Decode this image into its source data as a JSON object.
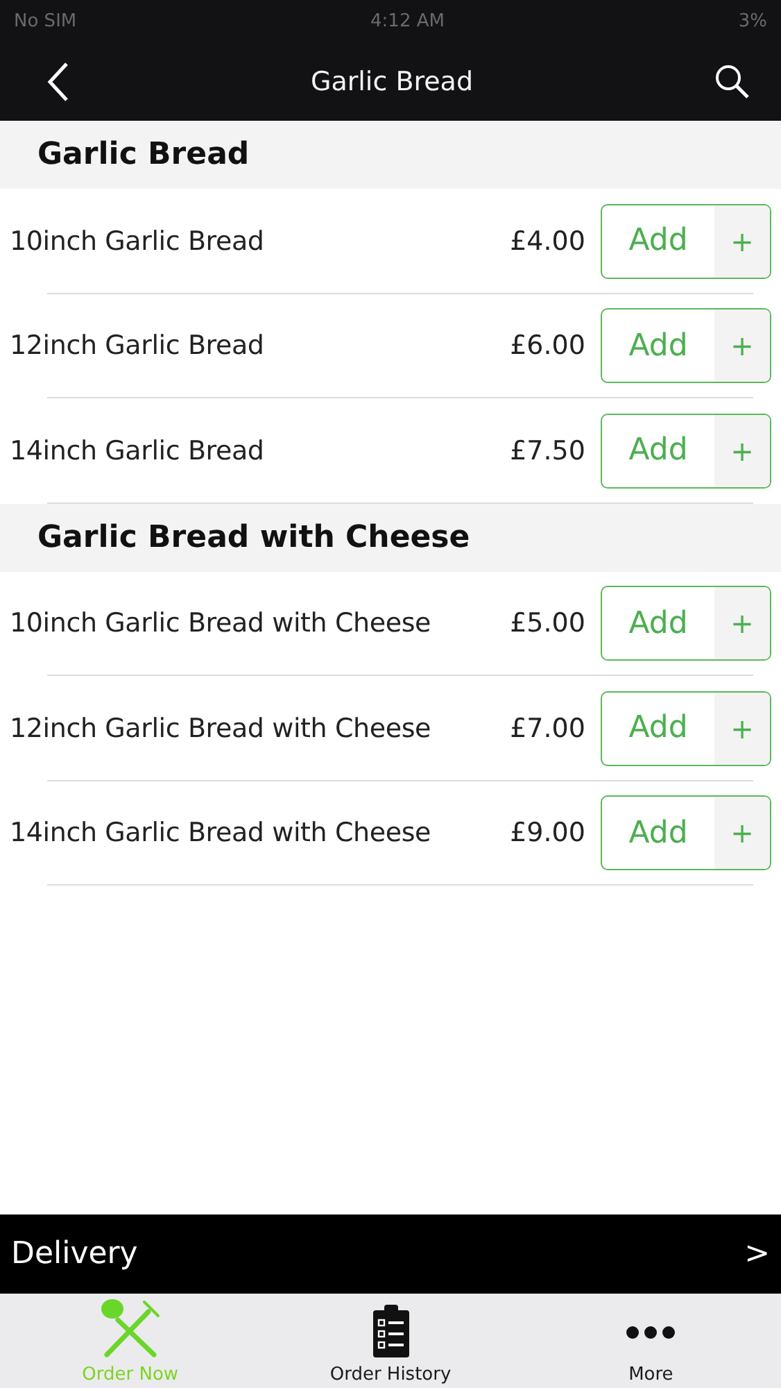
{
  "status_bar": {
    "carrier": "No SIM",
    "time": "4:12 AM",
    "battery": "3%"
  },
  "nav": {
    "title": "Garlic Bread"
  },
  "sections": [
    {
      "title": "Garlic Bread",
      "items": [
        {
          "name": "10inch Garlic Bread",
          "price": "£4.00",
          "button": "Add",
          "plus": "+"
        },
        {
          "name": "12inch Garlic Bread",
          "price": "£6.00",
          "button": "Add",
          "plus": "+"
        },
        {
          "name": "14inch Garlic Bread",
          "price": "£7.50",
          "button": "Add",
          "plus": "+"
        }
      ]
    },
    {
      "title": "Garlic Bread with Cheese",
      "items": [
        {
          "name": "10inch Garlic Bread with Cheese",
          "price": "£5.00",
          "button": "Add",
          "plus": "+"
        },
        {
          "name": "12inch Garlic Bread with Cheese",
          "price": "£7.00",
          "button": "Add",
          "plus": "+"
        },
        {
          "name": "14inch Garlic Bread with Cheese",
          "price": "£9.00",
          "button": "Add",
          "plus": "+"
        }
      ]
    }
  ],
  "delivery": {
    "label": "Delivery",
    "arrow": ">"
  },
  "tabs": [
    {
      "kind": "order",
      "label": "Order Now",
      "selected": true
    },
    {
      "kind": "history",
      "label": "Order History",
      "selected": false
    },
    {
      "kind": "more",
      "label": "More",
      "selected": false
    }
  ]
}
